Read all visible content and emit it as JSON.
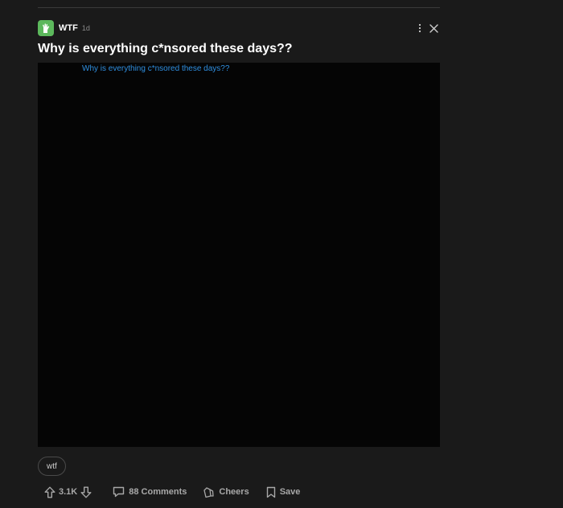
{
  "post": {
    "section": "WTF",
    "time": "1d",
    "title": "Why is everything c*nsored these days??",
    "media_alt": "Why is everything c*nsored these days??",
    "tag": "wtf",
    "icons": {
      "section_logo": "hand-icon",
      "more": "more-vertical-icon",
      "close": "close-icon",
      "upvote": "arrow-up-icon",
      "downvote": "arrow-down-icon",
      "comments": "comment-icon",
      "cheers": "cheers-icon",
      "save": "bookmark-icon"
    }
  },
  "actions": {
    "votes": "3.1K",
    "comments": "88 Comments",
    "cheers": "Cheers",
    "save": "Save"
  },
  "colors": {
    "background": "#1a1a1a",
    "media_background": "#050505",
    "section_green": "#5cb85c",
    "link_blue": "#2f8fe0",
    "muted_text": "#a8a8a8"
  }
}
